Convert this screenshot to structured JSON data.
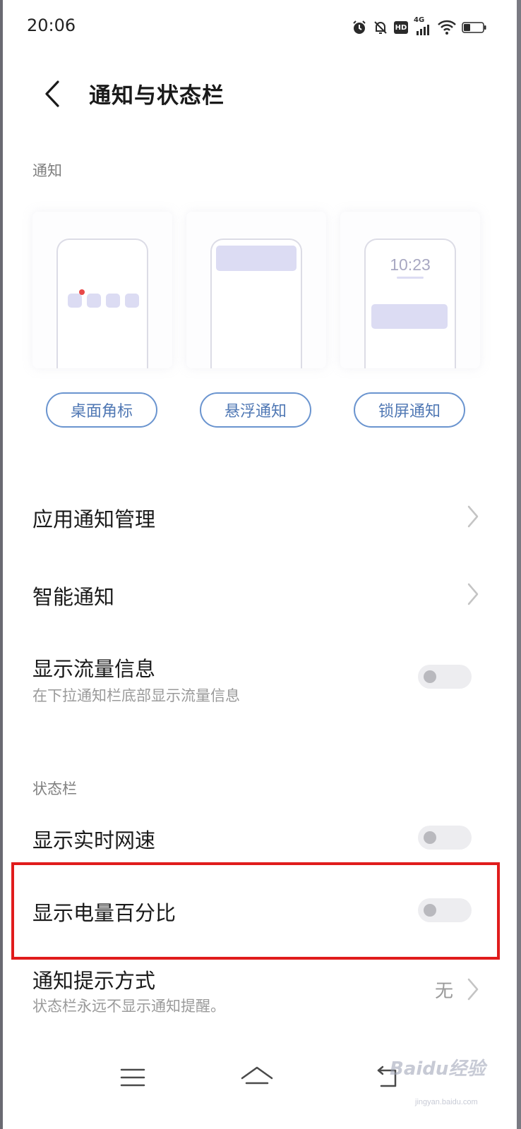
{
  "status_bar": {
    "time": "20:06",
    "icons": [
      "alarm-icon",
      "bell-off-icon",
      "hd-icon",
      "signal-4g-icon",
      "wifi-icon",
      "battery-icon"
    ],
    "hd_label": "HD",
    "network_label": "4G"
  },
  "header": {
    "title": "通知与状态栏"
  },
  "notification_section": {
    "label": "通知",
    "previews": [
      {
        "label": "桌面角标",
        "icon": "badge-preview"
      },
      {
        "label": "悬浮通知",
        "icon": "floating-preview"
      },
      {
        "label": "锁屏通知",
        "icon": "lockscreen-preview",
        "lock_time": "10:23"
      }
    ],
    "rows": [
      {
        "title": "应用通知管理",
        "type": "link"
      },
      {
        "title": "智能通知",
        "type": "link"
      },
      {
        "title": "显示流量信息",
        "subtitle": "在下拉通知栏底部显示流量信息",
        "type": "toggle",
        "on": false
      }
    ]
  },
  "status_bar_section": {
    "label": "状态栏",
    "rows": [
      {
        "title": "显示实时网速",
        "type": "toggle",
        "on": false
      },
      {
        "title": "显示电量百分比",
        "type": "toggle",
        "on": false,
        "highlighted": true
      },
      {
        "title": "通知提示方式",
        "subtitle": "状态栏永远不显示通知提醒。",
        "value": "无",
        "type": "link"
      }
    ]
  },
  "nav_bar": {
    "buttons": [
      "menu-icon",
      "home-icon",
      "back-return-icon"
    ]
  },
  "watermark": {
    "text": "Baidu经验",
    "sub": "jingyan.baidu.com"
  },
  "colors": {
    "accent": "#5078b4",
    "highlight": "#e01c1c",
    "preview_fill": "#dcdcf3"
  }
}
